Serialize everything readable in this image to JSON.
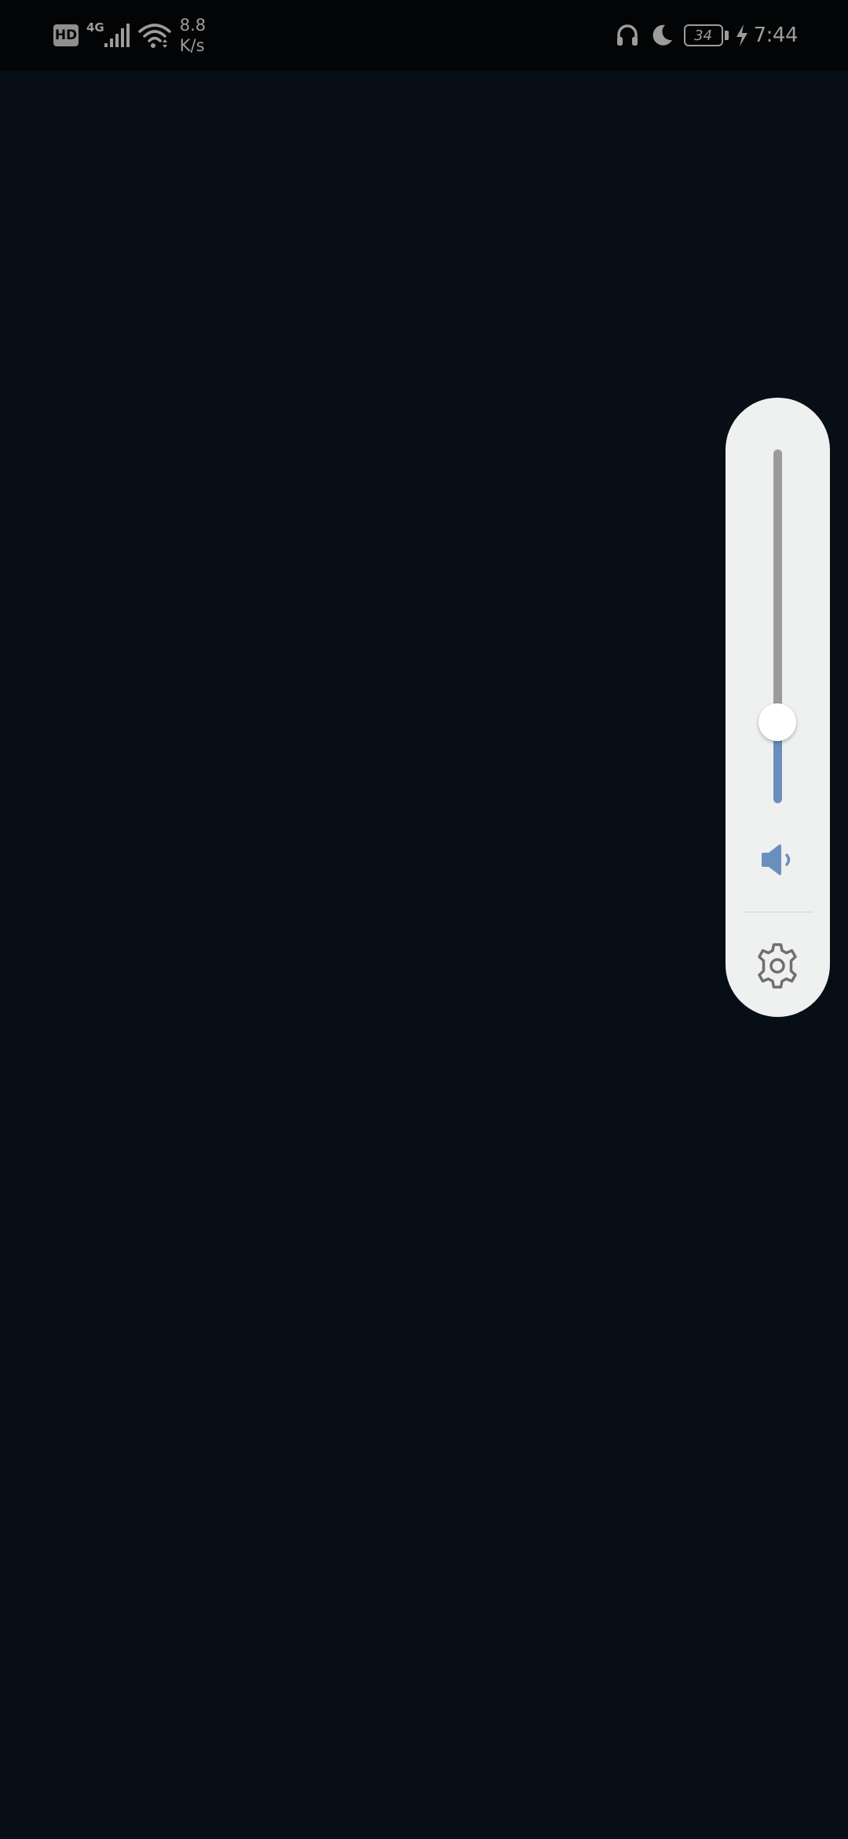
{
  "status_bar": {
    "hd_label": "HD",
    "network_type": "4G",
    "speed_value": "8.8",
    "speed_unit": "K/s",
    "battery_level": "34",
    "time": "7:44",
    "icons": [
      "hd-icon",
      "signal-icon",
      "wifi-icon",
      "headphones-icon",
      "moon-icon",
      "battery-icon",
      "charging-icon"
    ]
  },
  "volume_panel": {
    "level_percent": 23,
    "fill_color": "#6a8fbd",
    "track_color": "#9b9b9b",
    "panel_color": "#eff0f0",
    "speaker_icon": "speaker-icon",
    "settings_icon": "gear-icon"
  }
}
